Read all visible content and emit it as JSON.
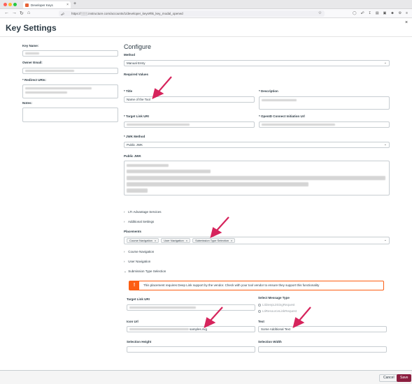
{
  "browser": {
    "tab_title": "Developer Keys",
    "url": "https://░░░.instructure.com/accounts/1/developer_keys#ltk_key_modal_opened",
    "tab_close": "×",
    "new_tab": "+"
  },
  "page": {
    "title": "Key Settings",
    "close": "×"
  },
  "left": {
    "key_name_label": "Key Name:",
    "owner_email_label": "Owner Email:",
    "redirect_uris_label": "* Redirect URIs:",
    "notes_label": "Notes:"
  },
  "configure": {
    "title": "Configure",
    "method_label": "Method",
    "method_value": "Manual Entry",
    "required_values_label": "Required Values",
    "title_label": "* Title",
    "title_value": "Name of the Tool",
    "description_label": "* Description",
    "target_link_uri_label": "* Target Link URI",
    "openid_label": "* OpenID Connect Initiation Url",
    "jwk_method_label": "* JWK Method",
    "jwk_method_value": "Public JWK",
    "public_jwk_label": "Public JWK",
    "lti_advantage_label": "LTI Advantage Services",
    "additional_settings_label": "Additional Settings",
    "placements_label": "Placements",
    "placements": [
      "Course Navigation",
      "User Navigation",
      "Submission Type Selection"
    ],
    "pill_remove": "×",
    "sections": [
      "Course Navigation",
      "User Navigation",
      "Submission Type Selection"
    ]
  },
  "submission_type": {
    "warning": "This placement requires Deep Link support by the vendor. Check with your tool vendor to ensure they support this functionality",
    "warning_icon": "!",
    "target_link_uri_label": "Target Link URI",
    "select_message_type_label": "Select Message Type",
    "message_types": [
      "LtiDeepLinkingRequest",
      "LtiResourceLinkRequest"
    ],
    "icon_url_label": "Icon Url",
    "icon_url_value": "samples.svg",
    "text_label": "Text",
    "text_value": "Some Additional Text",
    "selection_height_label": "Selection Height",
    "selection_width_label": "Selection Width"
  },
  "footer": {
    "cancel": "Cancel",
    "save": "Save"
  },
  "colors": {
    "accent": "#8b1e3f",
    "warning": "#fc5e13",
    "annotation_arrow": "#d6245c"
  }
}
